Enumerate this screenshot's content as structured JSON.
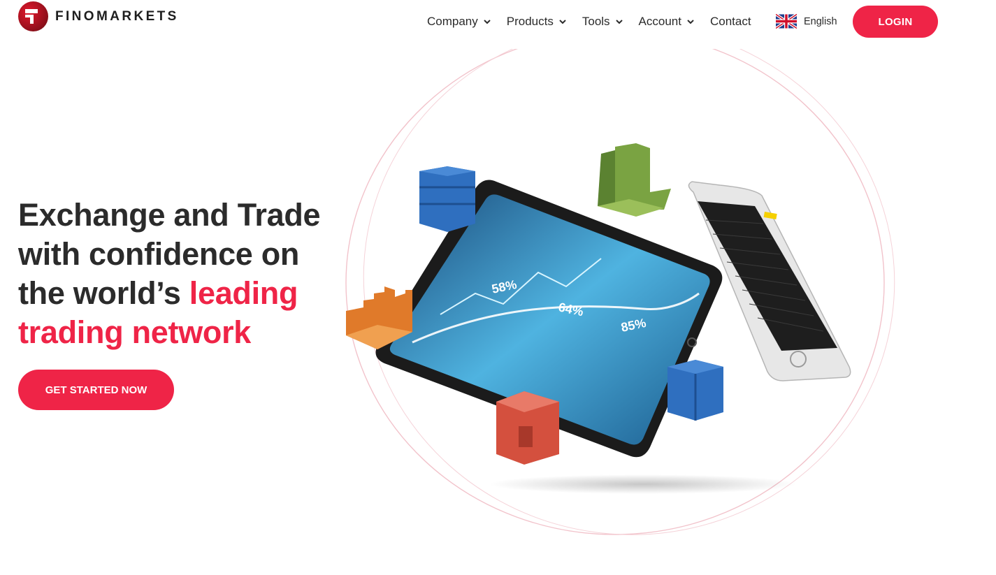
{
  "brand": {
    "name": "FINOMARKETS"
  },
  "nav": {
    "items": [
      {
        "label": "Company",
        "icon": "chevron-down-icon"
      },
      {
        "label": "Products",
        "icon": "chevron-down-icon"
      },
      {
        "label": "Tools",
        "icon": "chevron-down-icon"
      },
      {
        "label": "Account",
        "icon": "chevron-down-icon"
      }
    ],
    "contact": "Contact",
    "language": {
      "label": "English",
      "icon": "uk-flag-icon"
    },
    "login": "LOGIN"
  },
  "hero": {
    "line1": "Exchange and Trade",
    "line2": "with confidence on",
    "line3_prefix": "the world’s ",
    "line3_accent": "leading",
    "line4_accent": "trading network",
    "cta": "GET STARTED NOW"
  },
  "illustration": {
    "percents": [
      "58%",
      "64%",
      "85%"
    ]
  },
  "colors": {
    "accent": "#ef2447",
    "text": "#2b2b2b"
  }
}
